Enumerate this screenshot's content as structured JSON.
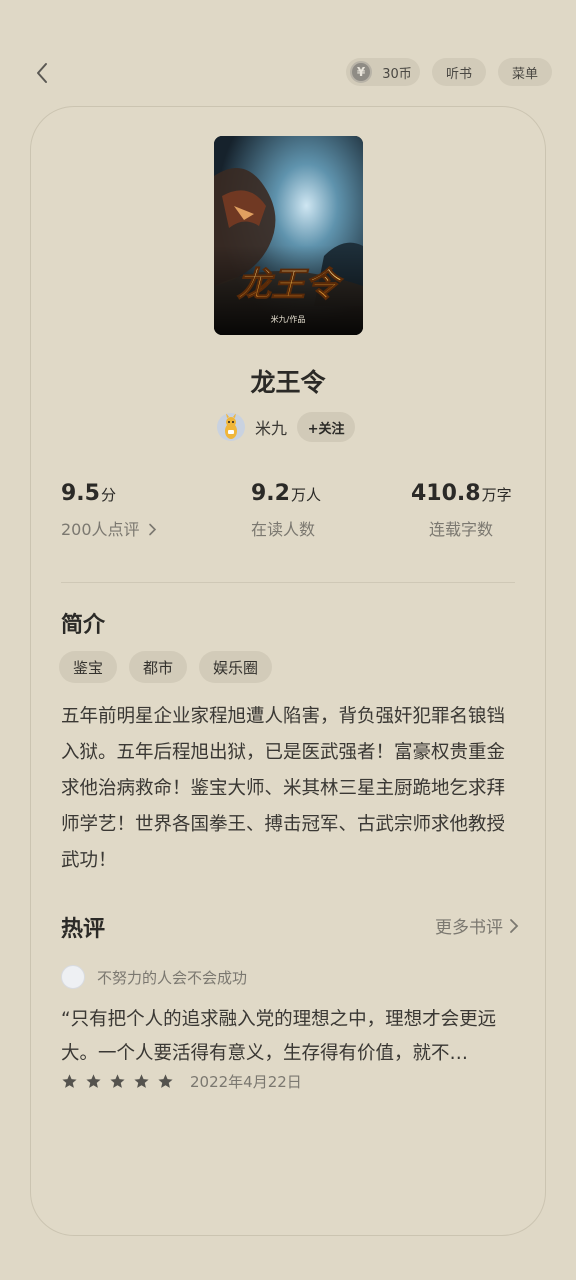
{
  "topbar": {
    "coins_label": "30币",
    "coin_symbol": "¥",
    "listen_label": "听书",
    "menu_label": "菜单"
  },
  "book": {
    "title": "龙王令",
    "cover_title": "龙王令",
    "cover_credit": "米九/作品",
    "author": "米九",
    "follow_label": "+关注"
  },
  "stats": [
    {
      "value": "9.5",
      "unit": "分",
      "sub": "200人点评"
    },
    {
      "value": "9.2",
      "unit": "万人",
      "sub": "在读人数"
    },
    {
      "value": "410.8",
      "unit": "万字",
      "sub": "连载字数"
    }
  ],
  "intro": {
    "title": "简介",
    "tags": [
      "鉴宝",
      "都市",
      "娱乐圈"
    ],
    "text": "五年前明星企业家程旭遭人陷害，背负强奸犯罪名锒铛入狱。五年后程旭出狱，已是医武强者！富豪权贵重金求他治病救命！鉴宝大师、米其林三星主厨跪地乞求拜师学艺！世界各国拳王、搏击冠军、古武宗师求他教授武功！"
  },
  "reviews": {
    "title": "热评",
    "more_label": "更多书评",
    "item": {
      "user": "不努力的人会不会成功",
      "text": "“只有把个人的追求融入党的理想之中，理想才会更远大。一个人要活得有意义，生存得有价值，就不…",
      "stars": 5,
      "date": "2022年4月22日"
    }
  },
  "colors": {
    "background": "#dfd8c6",
    "pill": "#d2cbb9",
    "text": "#2b2a27",
    "muted": "#7b7870"
  }
}
